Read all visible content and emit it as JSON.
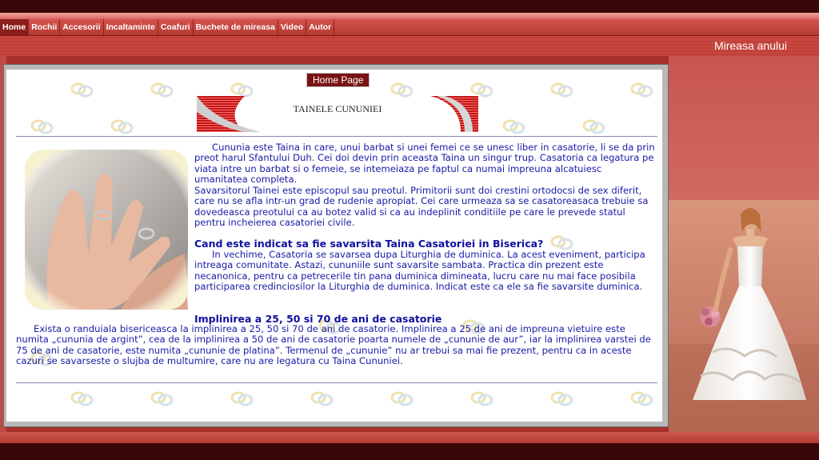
{
  "nav": {
    "items": [
      {
        "label": "Home",
        "active": true
      },
      {
        "label": "Rochii"
      },
      {
        "label": "Accesorii"
      },
      {
        "label": "Incaltaminte"
      },
      {
        "label": "Coafuri"
      },
      {
        "label": "Buchete de mireasa"
      },
      {
        "label": "Video"
      },
      {
        "label": "Autor"
      }
    ]
  },
  "header": {
    "right_title": "Mireasa anului"
  },
  "content": {
    "home_button": "Home Page",
    "banner_title": "TAINELE CUNUNIEI",
    "paragraph1": "Cununia este Taina in care, unui barbat si unei femei ce se unesc liber in casatorie, li se da prin preot harul Sfantului Duh. Cei doi devin prin aceasta Taina un singur trup. Casatoria ca legatura pe viata intre un barbat si o femeie, se intemeiaza pe faptul ca numai impreuna alcatuiesc umanitatea completa.",
    "paragraph2": "Savarsitorul Tainei este episcopul sau preotul. Primitorii sunt doi crestini ortodocsi de sex diferit, care nu se afla intr-un grad de rudenie apropiat. Cei care urmeaza sa se casatoreasaca trebuie sa dovedeasca preotului ca au botez valid si ca au indeplinit conditiile pe care le prevede statul pentru incheierea casatoriei civile.",
    "heading1": "Cand este indicat sa fie savarsita Taina Casatoriei in Biserica?",
    "paragraph3": "In vechime, Casatoria se savarsea dupa Liturghia de duminica. La acest eveniment, participa intreaga comunitate. Astazi, cununiile sunt savarsite sambata. Practica din prezent este necanonica, pentru ca petrecerile tin pana duminica dimineata, lucru care nu mai face posibila participarea credinciosilor la Liturghia de duminica. Indicat este ca ele sa fie savarsite duminica.",
    "heading2": "Implinirea a 25, 50 si 70 de ani de casatorie",
    "paragraph4": "Exista o randuiala bisericeasca la implinirea a 25, 50 si 70 de ani de casatorie. Implinirea a 25 de ani de impreuna vietuire este numita „cununia de argint”, cea de la implinirea a 50 de ani de casatorie poarta numele de „cununie de aur”, iar la implinirea varstei de 75 de ani de casatorie, este numita „cununie de platina”. Termenul de „cununie” nu ar trebui sa mai fie prezent, pentru ca in aceste cazuri se savarseste o slujba de multumire, care nu are legatura cu Taina Cununiei."
  },
  "icons": {
    "photo": "wedding-rings-hands-photo",
    "bride": "bride-photo",
    "watermark": "wedding-rings-icon"
  },
  "colors": {
    "nav_bg": "#c0443e",
    "dark_bar": "#3a0608",
    "text_blue": "#1a1aa8",
    "button_bg": "#7a1414"
  }
}
